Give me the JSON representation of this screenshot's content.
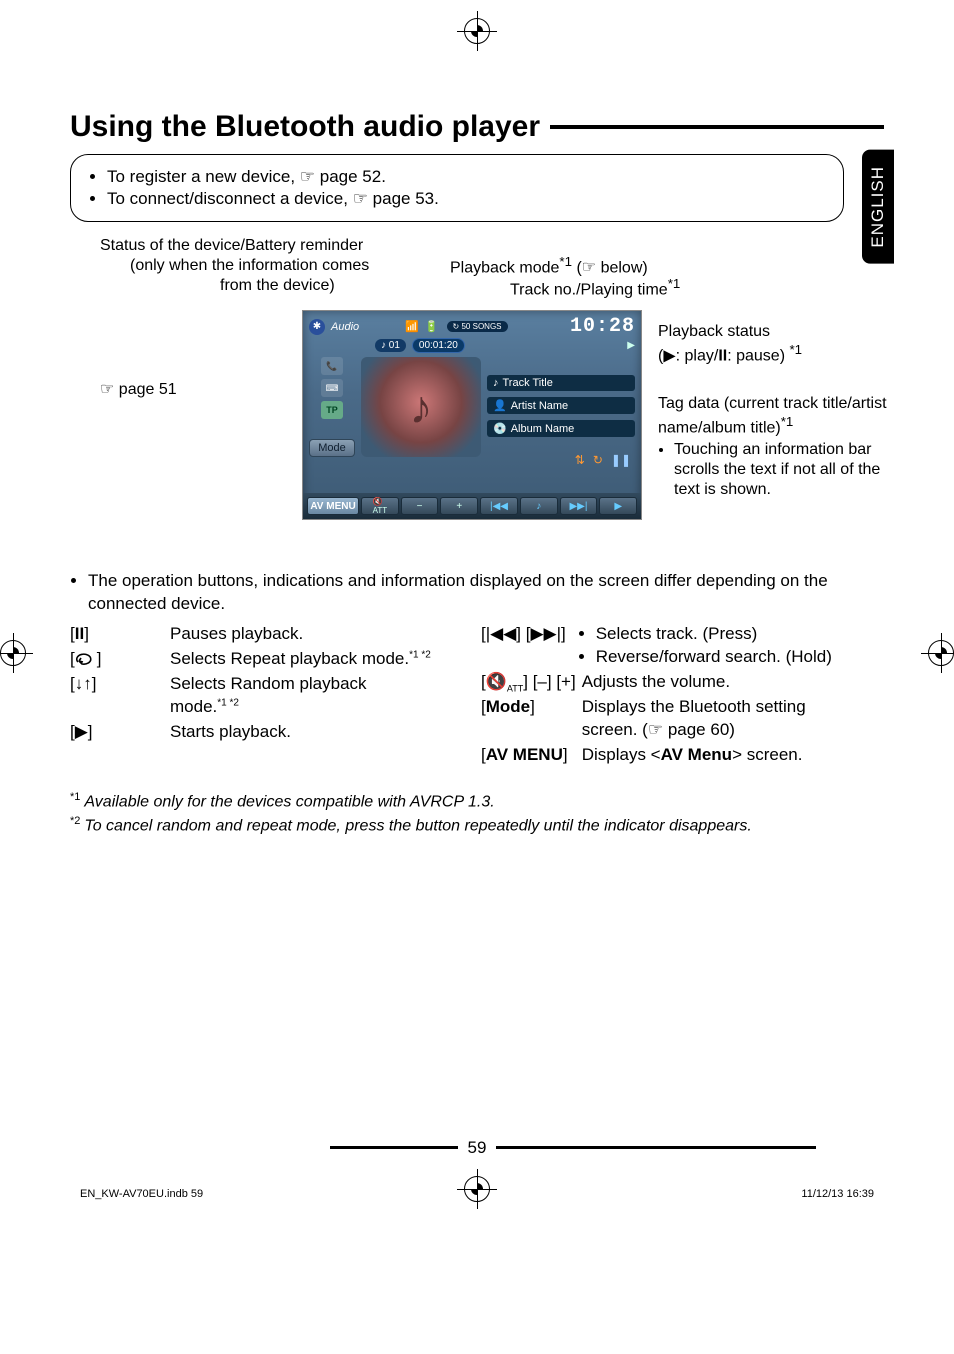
{
  "page": {
    "language_tab": "ENGLISH",
    "section_title": "Using the Bluetooth audio player",
    "page_number": "59",
    "footer_left": "EN_KW-AV70EU.indb   59",
    "footer_right": "11/12/13   16:39"
  },
  "notes_box": {
    "line1_pre": "To register a new device, ",
    "line1_post": " page 52.",
    "line2_pre": "To connect/disconnect a device, ",
    "line2_post": " page 53."
  },
  "diagram": {
    "status_label_l1": "Status of the device/Battery reminder",
    "status_label_l2": "(only when the information comes",
    "status_label_l3": "from the device)",
    "playback_mode_label_pre": "Playback mode",
    "playback_mode_label_post": " (",
    "playback_mode_label_post2": " below)",
    "track_no_label_pre": "Track no./Playing time",
    "page51_ref_pre": " page 51",
    "playback_status_label": "Playback status",
    "playback_status_detail_pre": "(",
    "playback_status_detail_play": ": play/",
    "playback_status_detail_pause": ": pause) ",
    "tag_l1": "Tag data (current track title/artist",
    "tag_l2": "name/album title)",
    "tag_b1": "Touching an information bar",
    "tag_b2": "scrolls the text if not all of the",
    "tag_b3": "text is shown.",
    "screen": {
      "audio_label": "Audio",
      "songs_label": "50 SONGS",
      "antenna_icon": "signal",
      "battery_icon": "batt",
      "track_no": "01",
      "playing_time": "00:01:20",
      "clock": "10:28",
      "track_title": "Track Title",
      "artist_name": "Artist Name",
      "album_name": "Album Name",
      "mode_btn": "Mode",
      "tp_label": "TP",
      "avmenu_label": "AV MENU",
      "att_label": "ATT"
    }
  },
  "note_after_diagram": "The operation buttons, indications and information displayed on the screen differ depending on the connected device.",
  "buttons_left": [
    {
      "symbol": "pause",
      "desc": "Pauses playback."
    },
    {
      "symbol": "repeat",
      "desc": "Selects Repeat playback mode.",
      "sup": "*1 *2"
    },
    {
      "symbol": "random",
      "desc_l1": "Selects Random playback",
      "desc_l2": "mode.",
      "sup": "*1 *2"
    },
    {
      "symbol": "play",
      "desc": "Starts playback."
    }
  ],
  "buttons_right": [
    {
      "symbol": "prevnext",
      "b1": "Selects track. (Press)",
      "b2": "Reverse/forward search. (Hold)"
    },
    {
      "symbol": "vol",
      "desc": "Adjusts the volume."
    },
    {
      "symbol_text": "Mode",
      "desc_l1": "Displays the Bluetooth setting",
      "desc_l2_pre": "screen. (",
      "desc_l2_post": " page 60)"
    },
    {
      "symbol_text": "AV MENU",
      "desc_pre": "Displays <",
      "desc_bold": "AV Menu",
      "desc_post": "> screen."
    }
  ],
  "footnotes": {
    "f1": "Available only for the devices compatible with AVRCP 1.3.",
    "f2": "To cancel random and repeat mode, press the button repeatedly until the indicator disappears."
  }
}
